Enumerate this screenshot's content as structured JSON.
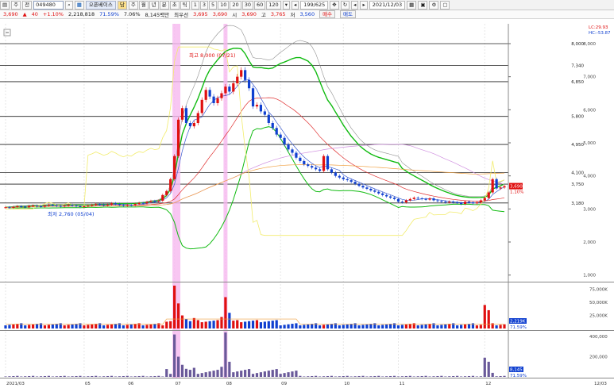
{
  "toolbar": {
    "menu_btn": "▤",
    "mode1": "주",
    "mode2": "전",
    "code": "049480",
    "stock_name": "오픈베이스",
    "credit_badge": "담",
    "periods": [
      "주",
      "월",
      "년",
      "분",
      "초",
      "틱"
    ],
    "intervals": [
      "1",
      "3",
      "5",
      "10",
      "20",
      "30",
      "60",
      "120"
    ],
    "count": "199",
    "total": "625",
    "date": "2021/12/03"
  },
  "quote": {
    "price": "3,690",
    "change_arrow": "▲",
    "change": "40",
    "change_pct": "+1.10%",
    "volume": "2,218,818",
    "volume_ratio": "71.59%",
    "turnover": "7.06%",
    "amount": "8,145백만",
    "best_ask_label": "최우선",
    "best_ask": "3,695",
    "best_bid": "3,690",
    "open_label": "시",
    "open": "3,690",
    "high_label": "고",
    "high": "3,765",
    "low_label": "저",
    "low": "3,560",
    "buy_button": "매수",
    "sell_button": "매도"
  },
  "price_axis": {
    "ticks": [
      "8,000",
      "7,000",
      "6,000",
      "5,000",
      "4,000",
      "3,000",
      "2,000",
      "1,000"
    ],
    "lines": [
      "8,000",
      "7,340",
      "6,850",
      "5,800",
      "4,950",
      "4,100",
      "3,750",
      "3,180"
    ],
    "current": "3,690",
    "current_pct": "1.10%",
    "lc": "LC:29.93",
    "hc": "HC:-53.87"
  },
  "annotations": {
    "high": "최고 8,000 (07/21)",
    "low": "최저 2,760 (05/04)"
  },
  "volume_axis": {
    "ticks": [
      "75,000K",
      "50,000K",
      "25,000K"
    ],
    "current": "2,219K",
    "ratio": "71.59%"
  },
  "amount_axis": {
    "ticks": [
      "400,000",
      "200,000"
    ],
    "current": "8,145",
    "ratio": "71.59%"
  },
  "x_axis": {
    "labels": [
      "2021/03",
      "05",
      "06",
      "07",
      "08",
      "09",
      "10",
      "11",
      "12"
    ],
    "end_label": "12/03"
  },
  "colors": {
    "up": "#e01010",
    "down": "#1040d0",
    "highlight": "#f6b8ef",
    "upper_band": "#11bb11",
    "lower_band": "#11bb11"
  },
  "chart_data": {
    "type": "candlestick",
    "title": "",
    "ylim": [
      800,
      8600
    ],
    "price_levels": [
      8000,
      7340,
      6850,
      5800,
      4950,
      4100,
      3750,
      3180
    ],
    "months": [
      "2021/03",
      "05",
      "06",
      "07",
      "08",
      "09",
      "10",
      "11",
      "12"
    ],
    "close": [
      3050,
      3040,
      3060,
      3080,
      3070,
      3050,
      3090,
      3100,
      3080,
      3070,
      3100,
      3120,
      3110,
      3090,
      3080,
      3100,
      3120,
      3100,
      3080,
      3060,
      3080,
      3100,
      3120,
      3150,
      3130,
      3110,
      3130,
      3170,
      3150,
      3120,
      3100,
      3120,
      3110,
      3150,
      3180,
      3170,
      3210,
      3240,
      3230,
      3250,
      3420,
      3540,
      3900,
      4600,
      5700,
      6050,
      5600,
      5500,
      5600,
      5900,
      6300,
      6600,
      6400,
      6200,
      6350,
      6500,
      6700,
      6550,
      6800,
      7000,
      7200,
      6900,
      6650,
      6100,
      6150,
      5950,
      5850,
      5600,
      5450,
      5250,
      5150,
      4950,
      4800,
      4700,
      4550,
      4450,
      4350,
      4300,
      4250,
      4200,
      4150,
      4600,
      4200,
      4100,
      4000,
      3950,
      3900,
      3870,
      3820,
      3760,
      3700,
      3650,
      3610,
      3560,
      3520,
      3470,
      3420,
      3380,
      3340,
      3300,
      3220,
      3200,
      3260,
      3300,
      3340,
      3320,
      3300,
      3280,
      3320,
      3260,
      3240,
      3220,
      3200,
      3220,
      3200,
      3180,
      3150,
      3220,
      3200,
      3170,
      3200,
      3260,
      3330,
      3500,
      3900,
      3620,
      3650,
      3690
    ]
  }
}
